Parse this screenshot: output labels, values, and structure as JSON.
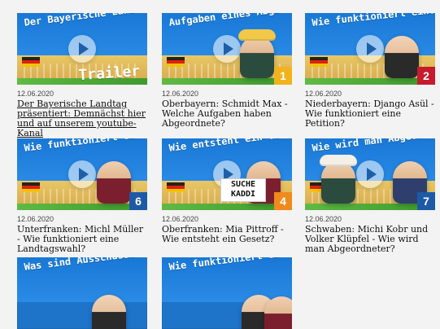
{
  "cards": [
    {
      "id": "card-1",
      "headline": "Der Bayerische Landtag präsentiert...",
      "overlay_word": "Trailer",
      "date": "12.06.2020",
      "title": "Der Bayerische Landtag präsentiert: Demnächst hier und auf unserem youtube-Kanal",
      "title_is_link": true,
      "badge": "",
      "badge_color": ""
    },
    {
      "id": "card-2",
      "headline": "Aufgaben eines Abgeordneten?",
      "overlay_word": "",
      "date": "12.06.2020",
      "title": "Oberbayern: Schmidt Max - Welche Aufgaben haben Abgeordnete?",
      "title_is_link": false,
      "badge": "1",
      "badge_color": "#f2b21b"
    },
    {
      "id": "card-3",
      "headline": "Wie funktioniert eine Petition?",
      "overlay_word": "",
      "date": "12.06.2020",
      "title": "Niederbayern: Django Asül - Wie funktioniert eine Petition?",
      "title_is_link": false,
      "badge": "2",
      "badge_color": "#c61b2c"
    },
    {
      "id": "card-4",
      "headline": "Wie funktioniert eine Landtagswahl?",
      "overlay_word": "",
      "date": "12.06.2020",
      "title": "Unterfranken: Michl Müller - Wie funktioniert eine Landtagswahl?",
      "title_is_link": false,
      "badge": "6",
      "badge_color": "#1c5aa6"
    },
    {
      "id": "card-5",
      "headline": "Wie entsteht ein Gesetz?",
      "overlay_word": "",
      "date": "12.06.2020",
      "title": "Oberfranken: Mia Pittroff - Wie entsteht ein Gesetz?",
      "title_is_link": false,
      "badge": "4",
      "badge_color": "#f08a1d",
      "sign_text": "SUCHE KADDI"
    },
    {
      "id": "card-6",
      "headline": "Wie wird man Abgeordneter?",
      "overlay_word": "",
      "date": "12.06.2020",
      "title": "Schwaben: Michi Kobr und Volker Klüpfel - Wie wird man Abgeordneter?",
      "title_is_link": false,
      "badge": "7",
      "badge_color": "#1c5aa6"
    },
    {
      "id": "card-7",
      "headline": "Was sind Ausschüsse?",
      "overlay_word": "",
      "date": "",
      "title": "",
      "title_is_link": false,
      "badge": "",
      "badge_color": ""
    },
    {
      "id": "card-8",
      "headline": "Wie funktioniert ein Volksentscheid?",
      "overlay_word": "",
      "date": "",
      "title": "",
      "title_is_link": false,
      "badge": "",
      "badge_color": ""
    }
  ],
  "colors": {
    "page_bg": "#f3f3f3",
    "thumb_blue": "#1e74c9",
    "play_overlay": "rgba(255,255,255,0.55)"
  },
  "icons": {
    "play": "play-icon"
  }
}
